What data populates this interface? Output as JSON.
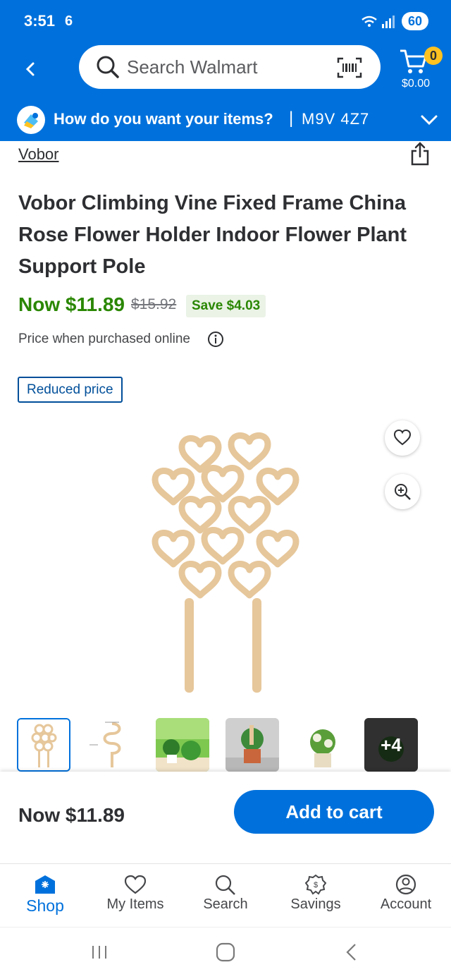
{
  "status": {
    "time": "3:51",
    "sim": "6",
    "battery": "60"
  },
  "header": {
    "search_placeholder": "Search Walmart",
    "cart_count": "0",
    "cart_total": "$0.00"
  },
  "delivery": {
    "question": "How do you want your items?",
    "separator": "|",
    "postal_code": "M9V 4Z7"
  },
  "product": {
    "brand": "Vobor",
    "title": "Vobor Climbing Vine Fixed Frame China Rose Flower Holder Indoor Flower Plant Support Pole",
    "price_now": "Now $11.89",
    "price_was": "$15.92",
    "save": "Save $4.03",
    "price_note": "Price when purchased online",
    "badge": "Reduced price",
    "more_images": "+4"
  },
  "buybar": {
    "price": "Now $11.89",
    "add_to_cart": "Add to cart"
  },
  "tabs": [
    {
      "label": "Shop",
      "icon": "shop-icon",
      "active": true
    },
    {
      "label": "My Items",
      "icon": "heart-icon"
    },
    {
      "label": "Search",
      "icon": "search-icon"
    },
    {
      "label": "Savings",
      "icon": "savings-icon"
    },
    {
      "label": "Account",
      "icon": "account-icon"
    }
  ],
  "colors": {
    "brand_blue": "#0071dc",
    "price_green": "#2a8703",
    "spark_yellow": "#ffc220"
  }
}
